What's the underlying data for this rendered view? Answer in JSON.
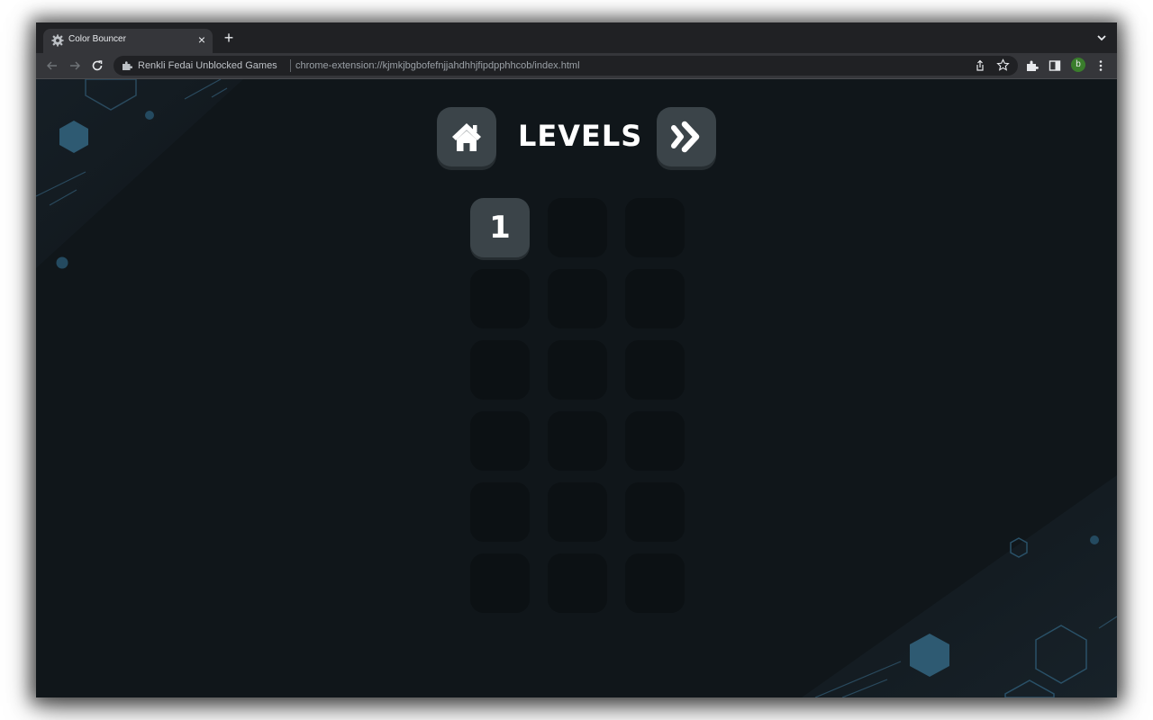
{
  "browser": {
    "tab_title": "Color Bouncer",
    "tab_close": "×",
    "new_tab": "+",
    "omnibox_site": "Renkli Fedai Unblocked Games",
    "omnibox_url": "chrome-extension://kjmkjbgbofefnjjahdhhjfipdpphhcob/index.html",
    "profile_initial": "b",
    "colors": {
      "frame": "#202124",
      "toolbar": "#35363a",
      "profile": "#3a7d2c"
    }
  },
  "game": {
    "title": "LEVELS",
    "home_button_icon": "home-icon",
    "next_button_icon": "double-chevron-right-icon",
    "levels": [
      {
        "label": "1",
        "unlocked": true
      },
      {
        "label": "",
        "unlocked": false
      },
      {
        "label": "",
        "unlocked": false
      },
      {
        "label": "",
        "unlocked": false
      },
      {
        "label": "",
        "unlocked": false
      },
      {
        "label": "",
        "unlocked": false
      },
      {
        "label": "",
        "unlocked": false
      },
      {
        "label": "",
        "unlocked": false
      },
      {
        "label": "",
        "unlocked": false
      },
      {
        "label": "",
        "unlocked": false
      },
      {
        "label": "",
        "unlocked": false
      },
      {
        "label": "",
        "unlocked": false
      },
      {
        "label": "",
        "unlocked": false
      },
      {
        "label": "",
        "unlocked": false
      },
      {
        "label": "",
        "unlocked": false
      },
      {
        "label": "",
        "unlocked": false
      },
      {
        "label": "",
        "unlocked": false
      },
      {
        "label": "",
        "unlocked": false
      }
    ],
    "colors": {
      "background": "#10161a",
      "button": "#3b4449",
      "locked_cell": "#0c1114",
      "accent": "#2e5a72"
    }
  }
}
